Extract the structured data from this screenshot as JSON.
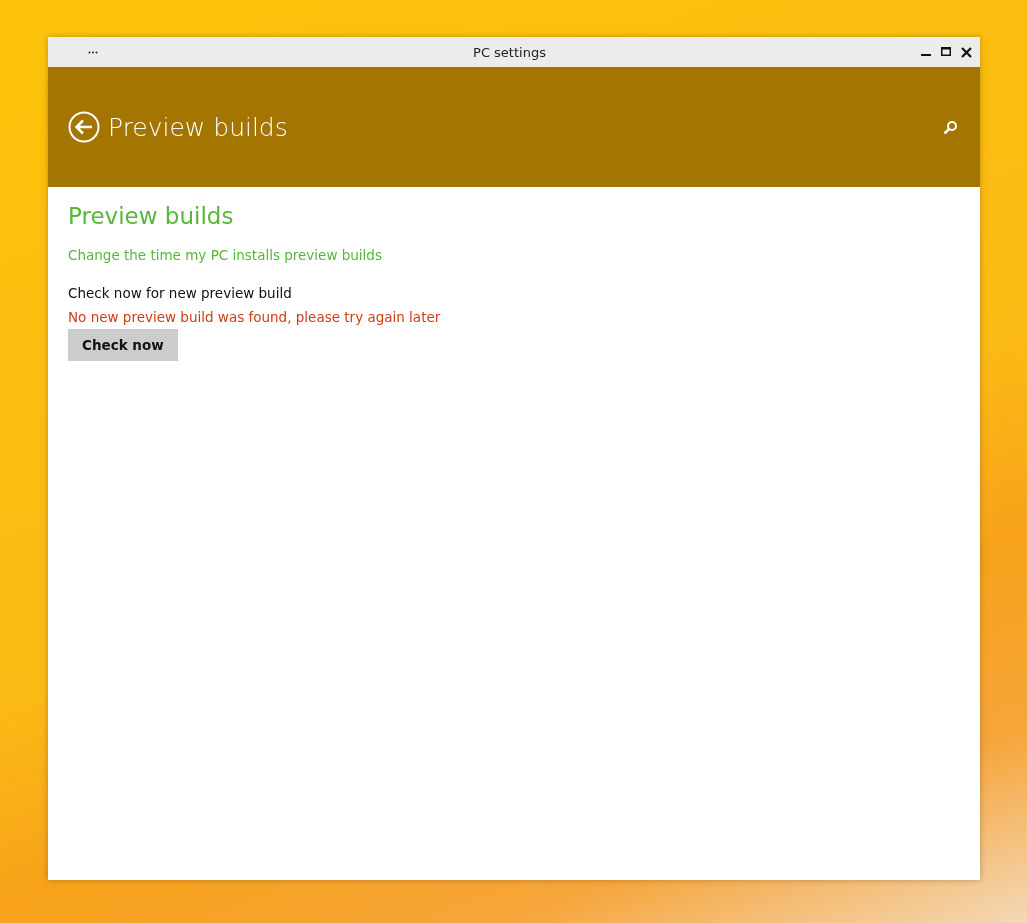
{
  "window": {
    "title": "PC settings"
  },
  "header": {
    "title": "Preview builds"
  },
  "content": {
    "heading": "Preview builds",
    "link": "Change the time my PC installs preview builds",
    "label": "Check now for new preview build",
    "status": "No new preview build was found, please try again later",
    "button": "Check now"
  }
}
